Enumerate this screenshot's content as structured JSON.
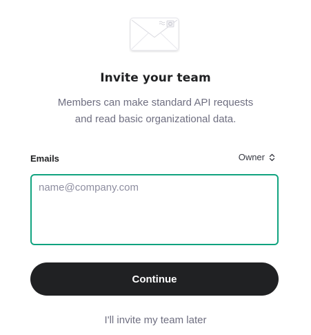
{
  "header": {
    "icon": "envelope-icon",
    "title": "Invite your team",
    "subtitle_line1": "Members can make standard API requests",
    "subtitle_line2": "and read basic organizational data."
  },
  "form": {
    "emails_label": "Emails",
    "role_selected": "Owner",
    "role_icon": "chevron-up-down-icon",
    "email_placeholder": "name@company.com",
    "email_value": ""
  },
  "actions": {
    "continue_label": "Continue",
    "later_label": "I'll invite my team later"
  },
  "colors": {
    "accent": "#10a37f",
    "button_bg": "#202123",
    "muted_text": "#6e6e80"
  }
}
